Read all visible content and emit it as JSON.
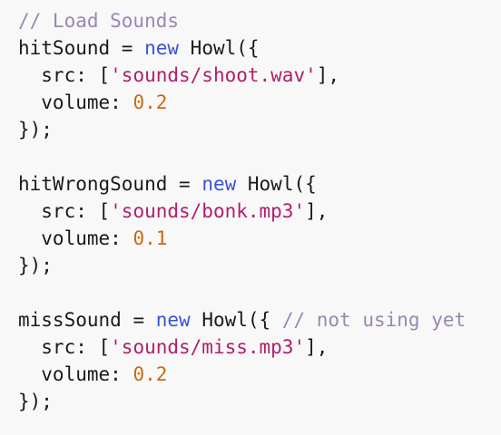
{
  "colors": {
    "background": "#f8f8f8",
    "text": "#1a1a1a",
    "comment": "#9a86b3",
    "keyword": "#3a52d6",
    "string": "#b0206b",
    "number": "#c76b16"
  },
  "code": {
    "comment_load": "// Load Sounds",
    "block1": {
      "var": "hitSound",
      "assign": " = ",
      "kw_new": "new",
      "ctor": " Howl({",
      "src_key": "  src: [",
      "src_val": "'sounds/shoot.wav'",
      "src_end": "],",
      "vol_key": "  volume: ",
      "vol_val": "0.2",
      "close": "});"
    },
    "block2": {
      "var": "hitWrongSound",
      "assign": " = ",
      "kw_new": "new",
      "ctor": " Howl({",
      "src_key": "  src: [",
      "src_val": "'sounds/bonk.mp3'",
      "src_end": "],",
      "vol_key": "  volume: ",
      "vol_val": "0.1",
      "close": "});"
    },
    "block3": {
      "var": "missSound",
      "assign": " = ",
      "kw_new": "new",
      "ctor": " Howl({ ",
      "comment": "// not using yet",
      "src_key": "  src: [",
      "src_val": "'sounds/miss.mp3'",
      "src_end": "],",
      "vol_key": "  volume: ",
      "vol_val": "0.2",
      "close": "});"
    }
  }
}
